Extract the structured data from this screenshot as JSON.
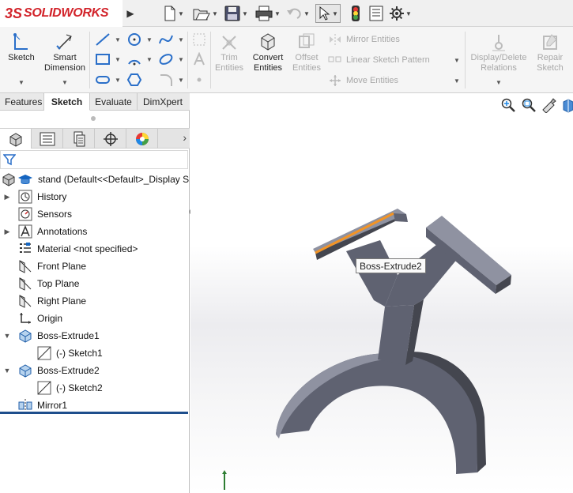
{
  "app": {
    "brand": "SOLIDWORKS",
    "brand_mark": "3S"
  },
  "colors": {
    "accent": "#d2232a",
    "model_face": "#5f6271",
    "model_top": "#8f92a1",
    "model_side": "#44464f",
    "selected_edge": "#f39425",
    "rollback_bar": "#1e4e8c"
  },
  "quick_access": [
    "new-document-icon",
    "open-icon",
    "save-icon",
    "print-icon",
    "undo-icon",
    "select-icon",
    "rebuild-icon",
    "file-properties-icon",
    "options-icon"
  ],
  "command_manager": {
    "sketch": "Sketch",
    "smart_dimension": "Smart Dimension",
    "trim_entities": "Trim Entities",
    "convert_entities": "Convert Entities",
    "offset_entities": "Offset Entities",
    "mirror_entities": "Mirror Entities",
    "linear_sketch_pattern": "Linear Sketch Pattern",
    "move_entities": "Move Entities",
    "display_delete_relations": "Display/Delete Relations",
    "repair_sketch": "Repair Sketch"
  },
  "tabs": [
    "Features",
    "Sketch",
    "Evaluate",
    "DimXpert"
  ],
  "active_tab": "Sketch",
  "tree": {
    "root": "stand  (Default<<Default>_Display S",
    "items": [
      {
        "label": "History",
        "icon": "history-icon",
        "expandable": true
      },
      {
        "label": "Sensors",
        "icon": "sensors-icon",
        "expandable": false
      },
      {
        "label": "Annotations",
        "icon": "annotations-icon",
        "expandable": true
      },
      {
        "label": "Material <not specified>",
        "icon": "material-icon",
        "expandable": false
      },
      {
        "label": "Front Plane",
        "icon": "plane-icon",
        "expandable": false
      },
      {
        "label": "Top Plane",
        "icon": "plane-icon",
        "expandable": false
      },
      {
        "label": "Right Plane",
        "icon": "plane-icon",
        "expandable": false
      },
      {
        "label": "Origin",
        "icon": "origin-icon",
        "expandable": false
      },
      {
        "label": "Boss-Extrude1",
        "icon": "extrude-icon",
        "expandable": true,
        "expanded": true
      },
      {
        "label": "(-) Sketch1",
        "icon": "sketch-icon",
        "child": true
      },
      {
        "label": "Boss-Extrude2",
        "icon": "extrude-icon",
        "expandable": true,
        "expanded": true
      },
      {
        "label": "(-) Sketch2",
        "icon": "sketch-icon",
        "child": true
      },
      {
        "label": "Mirror1",
        "icon": "mirror-icon",
        "expandable": false
      }
    ]
  },
  "graphics": {
    "tooltip": "Boss-Extrude2"
  }
}
